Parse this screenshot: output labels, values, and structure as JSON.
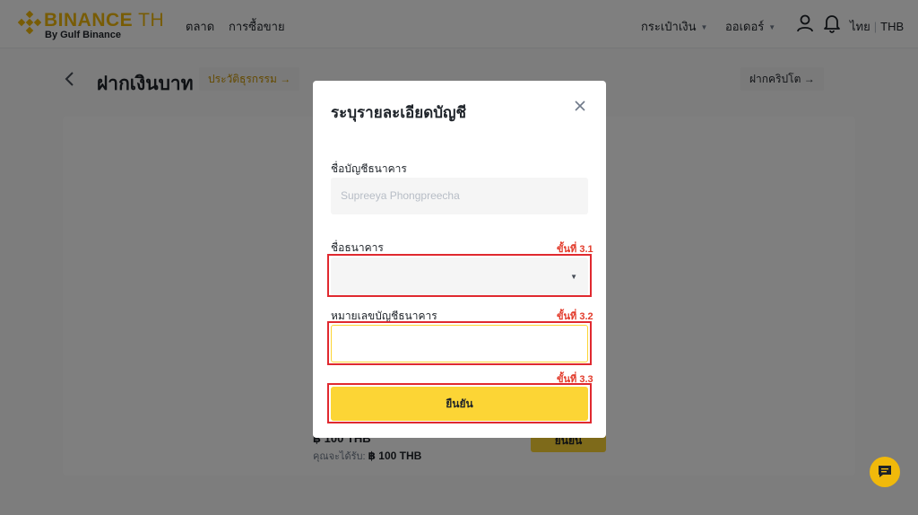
{
  "header": {
    "logo": {
      "brand": "BINANCE",
      "suffix": "TH",
      "sub": "By Gulf Binance"
    },
    "nav": [
      "ตลาด",
      "การซื้อขาย"
    ],
    "wallet_label": "กระเป๋าเงิน",
    "orders_label": "ออเดอร์",
    "language": "ไทย",
    "currency": "THB",
    "icons": [
      "user-icon",
      "bell-icon"
    ]
  },
  "page": {
    "title": "ฝากเงินบาท",
    "history_button": "ประวัติธุรกรรม →",
    "crypto_button": "ฝากคริปโต →",
    "amount_text": "฿ 100 THB",
    "receive_label": "คุณจะได้รับ:",
    "receive_value": "฿ 100 THB",
    "action_button": "ยืนยัน"
  },
  "modal": {
    "title": "ระบุรายละเอียดบัญชี",
    "account_name_label": "ชื่อบัญชีธนาคาร",
    "account_name_value": "Supreeya Phongpreecha",
    "bank_name_label": "ชื่อธนาคาร",
    "bank_name_value": "",
    "account_number_label": "หมายเลขบัญชีธนาคาร",
    "account_number_value": "",
    "confirm_button": "ยืนยัน",
    "steps": {
      "s1": "ขั้นที่ 3.1",
      "s2": "ขั้นที่ 3.2",
      "s3": "ขั้นที่ 3.3"
    }
  },
  "colors": {
    "brand": "#F0B90B",
    "button": "#FCD535",
    "annotation": "#E0292F"
  }
}
